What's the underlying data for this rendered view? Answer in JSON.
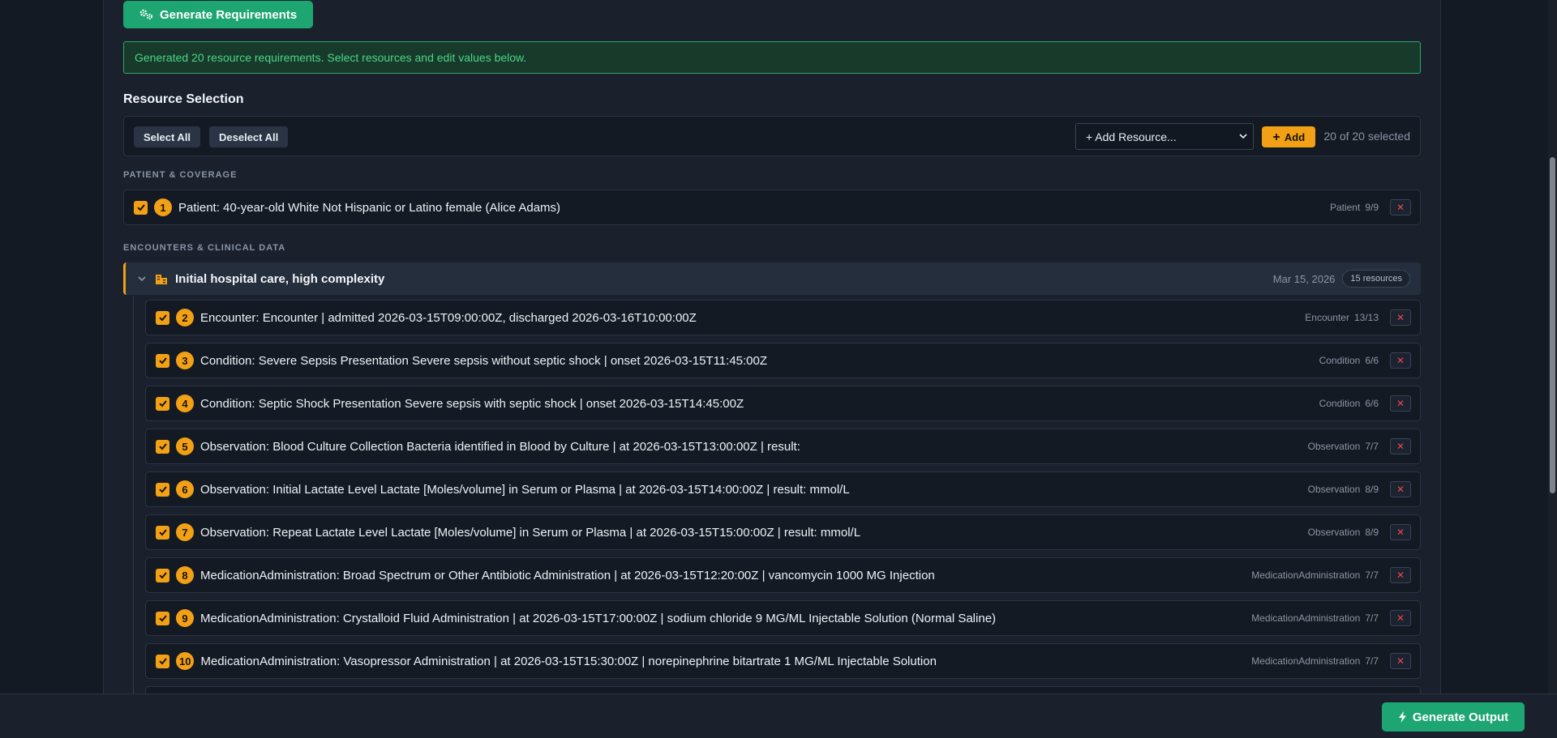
{
  "actions": {
    "generate_requirements": "Generate Requirements",
    "generate_output": "Generate Output"
  },
  "alert": {
    "message": "Generated 20 resource requirements. Select resources and edit values below."
  },
  "resource_selection": {
    "title": "Resource Selection",
    "select_all": "Select All",
    "deselect_all": "Deselect All",
    "add_resource_placeholder": "+ Add Resource...",
    "add_label": "Add",
    "selected_count": "20 of 20 selected"
  },
  "groups": {
    "patient_coverage": "PATIENT & COVERAGE",
    "encounters_clinical": "ENCOUNTERS & CLINICAL DATA"
  },
  "patient_row": {
    "num": "1",
    "text": "Patient: 40-year-old White Not Hispanic or Latino female (Alice Adams)",
    "type": "Patient",
    "count": "9/9",
    "remove": "✕"
  },
  "encounter": {
    "title": "Initial hospital care, high complexity",
    "date": "Mar 15, 2026",
    "badge": "15 resources"
  },
  "rows": [
    {
      "num": "2",
      "text": "Encounter: Encounter | admitted 2026-03-15T09:00:00Z, discharged 2026-03-16T10:00:00Z",
      "type": "Encounter",
      "count": "13/13",
      "remove": "✕"
    },
    {
      "num": "3",
      "text": "Condition: Severe Sepsis Presentation Severe sepsis without septic shock | onset 2026-03-15T11:45:00Z",
      "type": "Condition",
      "count": "6/6",
      "remove": "✕"
    },
    {
      "num": "4",
      "text": "Condition: Septic Shock Presentation Severe sepsis with septic shock | onset 2026-03-15T14:45:00Z",
      "type": "Condition",
      "count": "6/6",
      "remove": "✕"
    },
    {
      "num": "5",
      "text": "Observation: Blood Culture Collection Bacteria identified in Blood by Culture | at 2026-03-15T13:00:00Z | result:",
      "type": "Observation",
      "count": "7/7",
      "remove": "✕"
    },
    {
      "num": "6",
      "text": "Observation: Initial Lactate Level Lactate [Moles/volume] in Serum or Plasma | at 2026-03-15T14:00:00Z | result: mmol/L",
      "type": "Observation",
      "count": "8/9",
      "remove": "✕"
    },
    {
      "num": "7",
      "text": "Observation: Repeat Lactate Level Lactate [Moles/volume] in Serum or Plasma | at 2026-03-15T15:00:00Z | result: mmol/L",
      "type": "Observation",
      "count": "8/9",
      "remove": "✕"
    },
    {
      "num": "8",
      "text": "MedicationAdministration: Broad Spectrum or Other Antibiotic Administration | at 2026-03-15T12:20:00Z | vancomycin 1000 MG Injection",
      "type": "MedicationAdministration",
      "count": "7/7",
      "remove": "✕"
    },
    {
      "num": "9",
      "text": "MedicationAdministration: Crystalloid Fluid Administration | at 2026-03-15T17:00:00Z | sodium chloride 9 MG/ML Injectable Solution (Normal Saline)",
      "type": "MedicationAdministration",
      "count": "7/7",
      "remove": "✕"
    },
    {
      "num": "10",
      "text": "MedicationAdministration: Vasopressor Administration | at 2026-03-15T15:30:00Z | norepinephrine bitartrate 1 MG/ML Injectable Solution",
      "type": "MedicationAdministration",
      "count": "7/7",
      "remove": "✕"
    }
  ],
  "icons": {
    "generate": "gears-icon",
    "encounter": "hospital-icon",
    "collapse": "chevron-down-icon",
    "remove": "close-icon",
    "output": "bolt-icon"
  },
  "colors": {
    "accent": "#f2a116",
    "success": "#1ea672",
    "danger": "#e5484d"
  }
}
